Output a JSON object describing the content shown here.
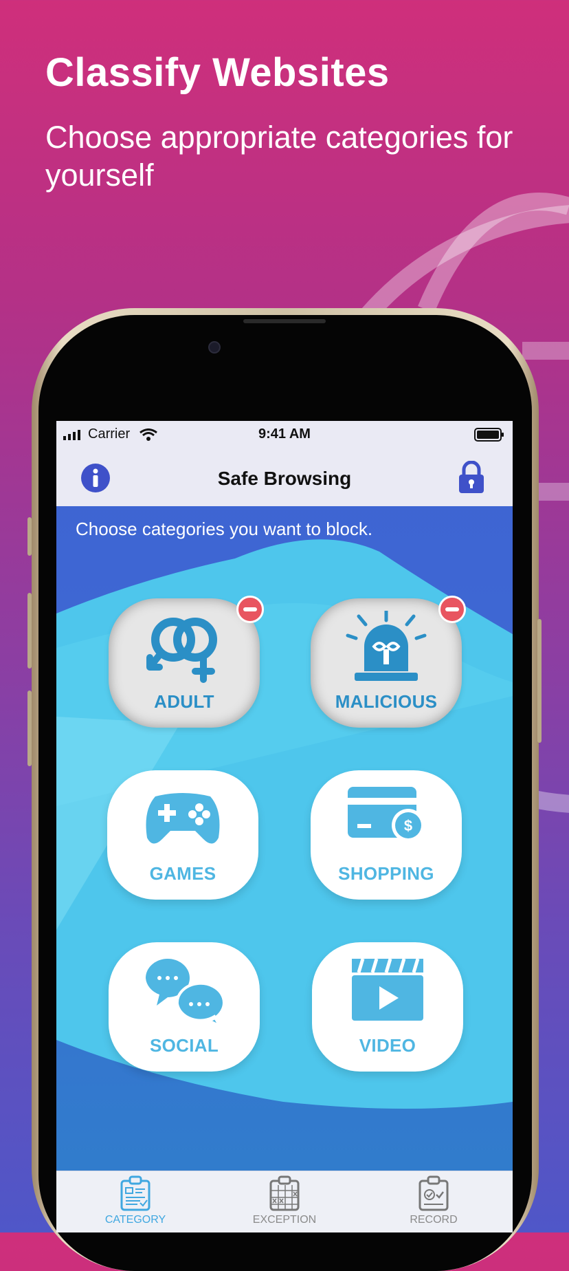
{
  "header": {
    "title": "Classify Websites",
    "subtitle": "Choose appropriate categories for yourself"
  },
  "status_bar": {
    "carrier": "Carrier",
    "time": "9:41 AM"
  },
  "nav": {
    "title": "Safe Browsing",
    "info_icon": "info-icon",
    "lock_icon": "lock-icon"
  },
  "instruction": "Choose categories you want to block.",
  "categories": [
    {
      "label": "ADULT",
      "icon": "gender-icon",
      "blocked": true
    },
    {
      "label": "MALICIOUS",
      "icon": "alarm-icon",
      "blocked": true
    },
    {
      "label": "GAMES",
      "icon": "gamepad-icon",
      "blocked": false
    },
    {
      "label": "SHOPPING",
      "icon": "credit-card-icon",
      "blocked": false
    },
    {
      "label": "SOCIAL",
      "icon": "chat-bubbles-icon",
      "blocked": false
    },
    {
      "label": "VIDEO",
      "icon": "clapperboard-icon",
      "blocked": false
    }
  ],
  "tabs": [
    {
      "label": "CATEGORY",
      "icon": "clipboard-list-icon",
      "active": true
    },
    {
      "label": "EXCEPTION",
      "icon": "clipboard-grid-icon",
      "active": false
    },
    {
      "label": "RECORD",
      "icon": "clipboard-check-icon",
      "active": false
    }
  ],
  "colors": {
    "accent": "#3fa7e0",
    "icon_blue": "#2b8fc6",
    "blocked_badge": "#e85560",
    "nav_icon": "#3f51c9"
  }
}
